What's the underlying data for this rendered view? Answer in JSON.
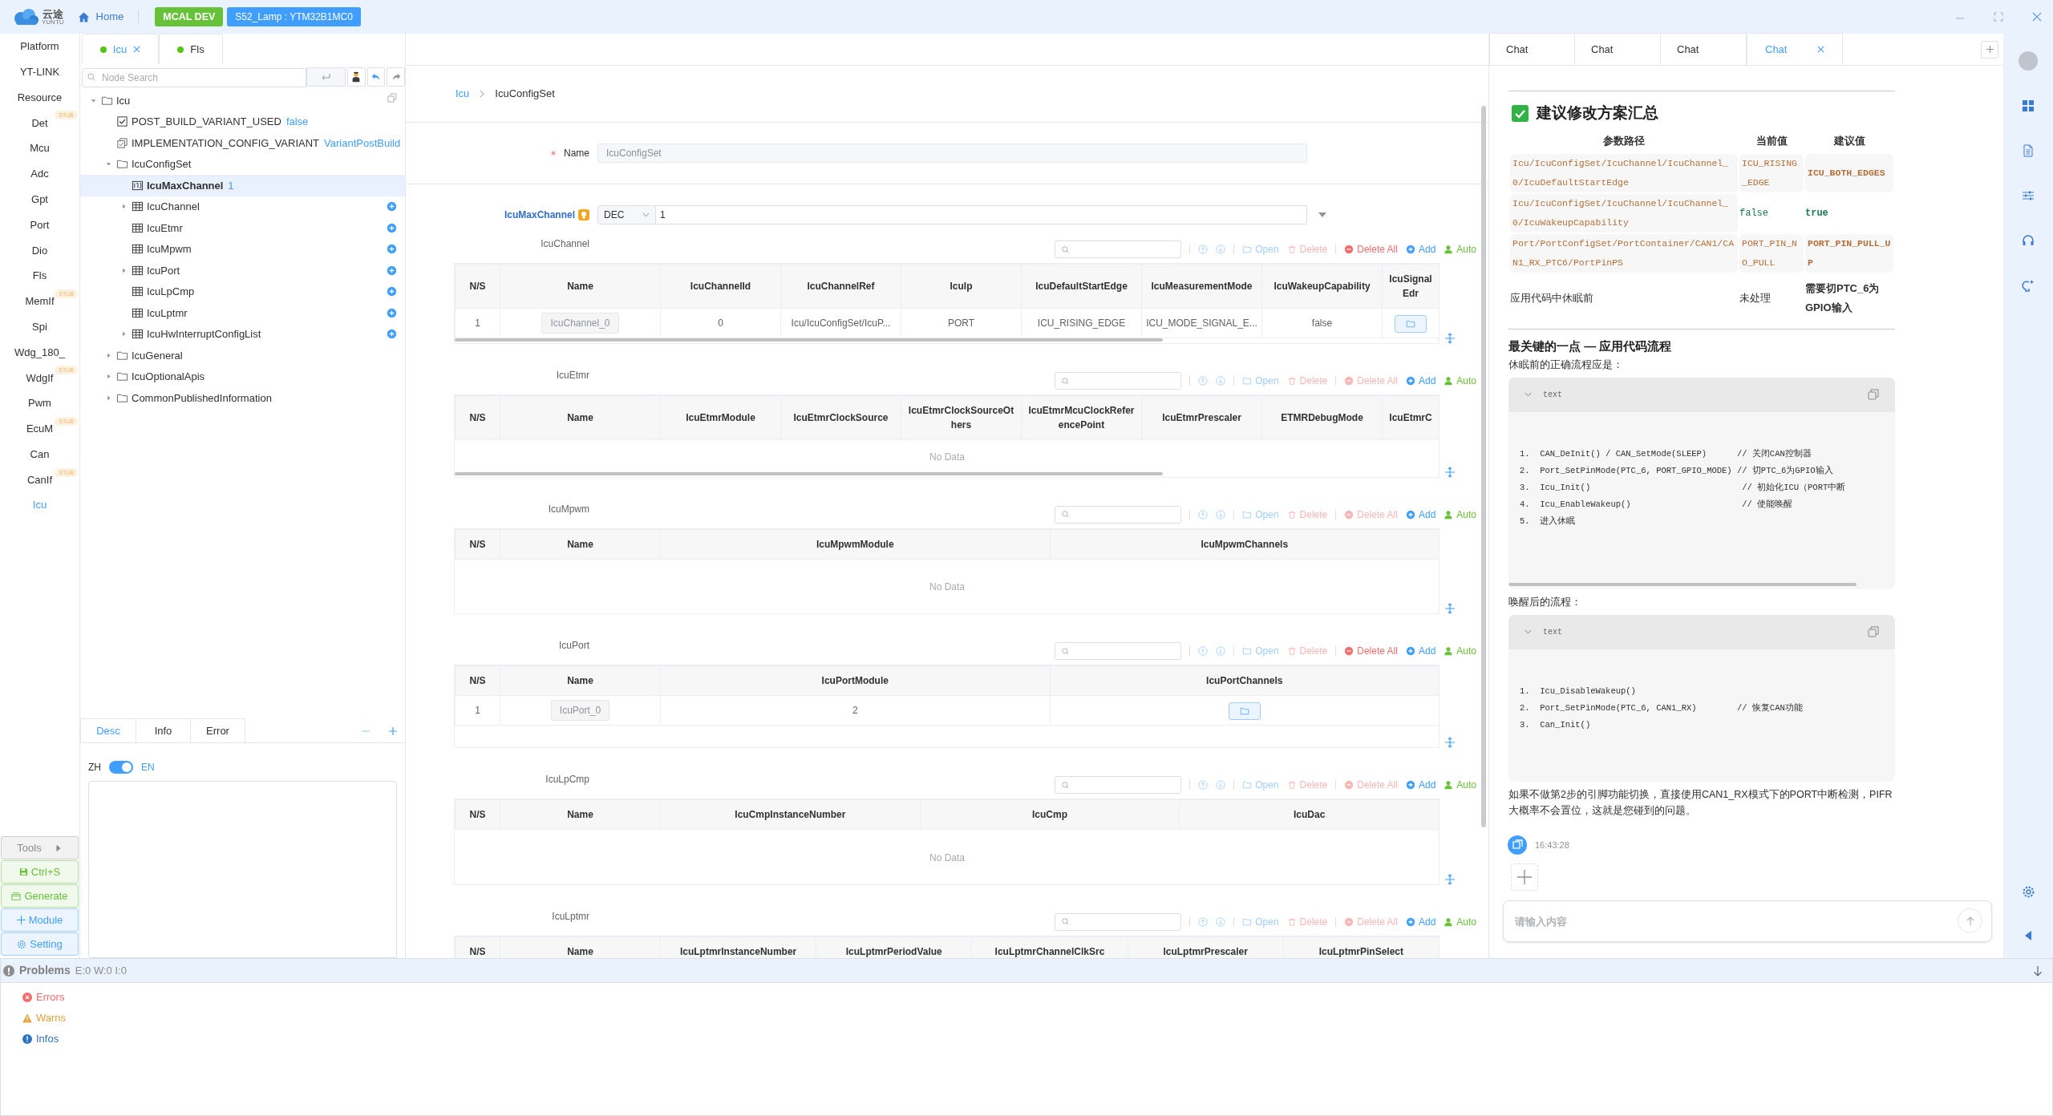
{
  "header": {
    "logo_text": "云途",
    "logo_subtext": "YUNTU",
    "home": "Home",
    "badges": [
      {
        "label": "MCAL DEV",
        "color": "#67c23a"
      },
      {
        "label": "S52_Lamp : YTM32B1MC0",
        "color": "#409eff"
      }
    ]
  },
  "nav": [
    {
      "label": "Platform",
      "selected": false
    },
    {
      "label": "YT-LINK",
      "selected": false
    },
    {
      "label": "Resource",
      "selected": false
    },
    {
      "label": "Det",
      "badge": "STUB",
      "selected": false
    },
    {
      "label": "Mcu",
      "selected": false
    },
    {
      "label": "Adc",
      "selected": false
    },
    {
      "label": "Gpt",
      "selected": false
    },
    {
      "label": "Port",
      "selected": false
    },
    {
      "label": "Dio",
      "selected": false
    },
    {
      "label": "Fls",
      "selected": false
    },
    {
      "label": "MemIf",
      "badge": "STUB",
      "selected": false
    },
    {
      "label": "Spi",
      "selected": false
    },
    {
      "label": "Wdg_180_",
      "selected": false
    },
    {
      "label": "WdgIf",
      "badge": "STUB",
      "selected": false
    },
    {
      "label": "Pwm",
      "selected": false
    },
    {
      "label": "EcuM",
      "badge": "STUB",
      "selected": false
    },
    {
      "label": "Can",
      "selected": false
    },
    {
      "label": "CanIf",
      "badge": "STUB",
      "selected": false
    },
    {
      "label": "Icu",
      "selected": true
    }
  ],
  "tools": [
    {
      "kind": "tools",
      "label": "Tools"
    },
    {
      "kind": "save",
      "label": "Ctrl+S"
    },
    {
      "kind": "generate",
      "label": "Generate"
    },
    {
      "kind": "module",
      "label": "Module"
    },
    {
      "kind": "setting",
      "label": "Setting"
    }
  ],
  "module_tabs": [
    {
      "label": "Icu",
      "selected": true
    },
    {
      "label": "Fls",
      "selected": false
    }
  ],
  "node_search": {
    "placeholder": "Node Search"
  },
  "tree": [
    {
      "label": "Icu",
      "kind": "folder",
      "expanded": true,
      "selected": false,
      "children": [
        {
          "label": "POST_BUILD_VARIANT_USED",
          "kind": "boolean",
          "value": "false",
          "selected": false
        },
        {
          "label": "IMPLEMENTATION_CONFIG_VARIANT",
          "kind": "enum",
          "value": "VariantPostBuild",
          "selected": false
        },
        {
          "label": "IcuConfigSet",
          "kind": "folder",
          "expanded": true,
          "selected": false,
          "children": [
            {
              "label": "IcuMaxChannel",
              "kind": "number",
              "value": "1",
              "selected": true
            },
            {
              "label": "IcuChannel",
              "kind": "table",
              "expanded": false,
              "add": true,
              "selected": false
            },
            {
              "label": "IcuEtmr",
              "kind": "table",
              "add": true,
              "selected": false
            },
            {
              "label": "IcuMpwm",
              "kind": "table",
              "add": true,
              "selected": false
            },
            {
              "label": "IcuPort",
              "kind": "table",
              "expanded": false,
              "add": true,
              "selected": false
            },
            {
              "label": "IcuLpCmp",
              "kind": "table",
              "add": true,
              "selected": false
            },
            {
              "label": "IcuLptmr",
              "kind": "table",
              "add": true,
              "selected": false
            },
            {
              "label": "IcuHwInterruptConfigList",
              "kind": "table",
              "expanded": false,
              "add": true,
              "selected": false
            }
          ]
        },
        {
          "label": "IcuGeneral",
          "kind": "folder",
          "expanded": false,
          "selected": false
        },
        {
          "label": "IcuOptionalApis",
          "kind": "folder",
          "expanded": false,
          "selected": false
        },
        {
          "label": "CommonPublishedInformation",
          "kind": "folder",
          "expanded": false,
          "selected": false
        }
      ]
    }
  ],
  "desc": {
    "tabs": [
      {
        "label": "Desc",
        "selected": true
      },
      {
        "label": "Info",
        "selected": false
      },
      {
        "label": "Error",
        "selected": false
      }
    ],
    "toggle": {
      "left": "ZH",
      "right": "EN",
      "on": true
    }
  },
  "breadcrumb": [
    "Icu",
    "IcuConfigSet"
  ],
  "name_field": {
    "label": "Name",
    "required": true,
    "value": "IcuConfigSet"
  },
  "max_channel": {
    "label": "IcuMaxChannel",
    "format": "DEC",
    "value": "1"
  },
  "tables": [
    {
      "title": "IcuChannel",
      "scroll": true,
      "actions": [
        {
          "kind": "open",
          "label": "Open",
          "enabled": false
        },
        {
          "kind": "delete",
          "label": "Delete",
          "enabled": false
        },
        {
          "kind": "delete_all",
          "label": "Delete All",
          "enabled": true
        },
        {
          "kind": "add",
          "label": "Add",
          "enabled": true
        },
        {
          "kind": "auto",
          "label": "Auto",
          "enabled": true
        }
      ],
      "columns": [
        "N/S",
        "Name",
        "IcuChannelId",
        "IcuChannelRef",
        "IcuIp",
        "IcuDefaultStartEdge",
        "IcuMeasurementMode",
        "IcuWakeupCapability",
        "IcuSignalEdr"
      ],
      "rows": [
        [
          "1",
          {
            "kind": "name",
            "text": "IcuChannel_0"
          },
          "0",
          "Icu/IcuConfigSet/IcuP...",
          "PORT",
          "ICU_RISING_EDGE",
          "ICU_MODE_SIGNAL_E...",
          "false",
          {
            "kind": "folder"
          }
        ]
      ]
    },
    {
      "title": "IcuEtmr",
      "scroll": true,
      "actions": [
        {
          "kind": "open",
          "label": "Open",
          "enabled": false
        },
        {
          "kind": "delete",
          "label": "Delete",
          "enabled": false
        },
        {
          "kind": "delete_all",
          "label": "Delete All",
          "enabled": false
        },
        {
          "kind": "add",
          "label": "Add",
          "enabled": true
        },
        {
          "kind": "auto",
          "label": "Auto",
          "enabled": true
        }
      ],
      "columns": [
        "N/S",
        "Name",
        "IcuEtmrModule",
        "IcuEtmrClockSource",
        "IcuEtmrClockSourceOthers",
        "IcuEtmrMcuClockReferencePoint",
        "IcuEtmrPrescaler",
        "ETMRDebugMode",
        "IcuEtmrC"
      ],
      "empty_text": "No Data"
    },
    {
      "title": "IcuMpwm",
      "scroll": false,
      "actions": [
        {
          "kind": "open",
          "label": "Open",
          "enabled": false
        },
        {
          "kind": "delete",
          "label": "Delete",
          "enabled": false
        },
        {
          "kind": "delete_all",
          "label": "Delete All",
          "enabled": false
        },
        {
          "kind": "add",
          "label": "Add",
          "enabled": true
        },
        {
          "kind": "auto",
          "label": "Auto",
          "enabled": true
        }
      ],
      "columns": [
        "N/S",
        "Name",
        "IcuMpwmModule",
        "IcuMpwmChannels"
      ],
      "empty_text": "No Data"
    },
    {
      "title": "IcuPort",
      "scroll": false,
      "actions": [
        {
          "kind": "open",
          "label": "Open",
          "enabled": false
        },
        {
          "kind": "delete",
          "label": "Delete",
          "enabled": false
        },
        {
          "kind": "delete_all",
          "label": "Delete All",
          "enabled": true
        },
        {
          "kind": "add",
          "label": "Add",
          "enabled": true
        },
        {
          "kind": "auto",
          "label": "Auto",
          "enabled": true
        }
      ],
      "columns": [
        "N/S",
        "Name",
        "IcuPortModule",
        "IcuPortChannels"
      ],
      "rows": [
        [
          "1",
          {
            "kind": "name",
            "text": "IcuPort_0"
          },
          "2",
          {
            "kind": "folder"
          }
        ]
      ]
    },
    {
      "title": "IcuLpCmp",
      "scroll": false,
      "actions": [
        {
          "kind": "open",
          "label": "Open",
          "enabled": false
        },
        {
          "kind": "delete",
          "label": "Delete",
          "enabled": false
        },
        {
          "kind": "delete_all",
          "label": "Delete All",
          "enabled": false
        },
        {
          "kind": "add",
          "label": "Add",
          "enabled": true
        },
        {
          "kind": "auto",
          "label": "Auto",
          "enabled": true
        }
      ],
      "columns": [
        "N/S",
        "Name",
        "IcuCmpInstanceNumber",
        "IcuCmp",
        "IcuDac"
      ],
      "empty_text": "No Data"
    },
    {
      "title": "IcuLptmr",
      "scroll": false,
      "actions": [
        {
          "kind": "open",
          "label": "Open",
          "enabled": false
        },
        {
          "kind": "delete",
          "label": "Delete",
          "enabled": false
        },
        {
          "kind": "delete_all",
          "label": "Delete All",
          "enabled": false
        },
        {
          "kind": "add",
          "label": "Add",
          "enabled": true
        },
        {
          "kind": "auto",
          "label": "Auto",
          "enabled": true
        }
      ],
      "columns": [
        "N/S",
        "Name",
        "IcuLptmrInstanceNumber",
        "IcuLptmrPeriodValue",
        "IcuLptmrChannelClkSrc",
        "IcuLptmrPrescaler",
        "IcuLptmrPinSelect"
      ]
    }
  ],
  "chat": {
    "tabs": [
      {
        "label": "Chat",
        "selected": false
      },
      {
        "label": "Chat",
        "selected": false
      },
      {
        "label": "Chat",
        "selected": false
      },
      {
        "label": "Chat",
        "selected": true
      }
    ],
    "blocks": [
      {
        "kind": "heading",
        "text": "建议修改方案汇总"
      },
      {
        "kind": "table",
        "columns": [
          "参数路径",
          "当前值",
          "建议值"
        ],
        "rows": [
          [
            {
              "kind": "code",
              "text": "Icu/IcuConfigSet/IcuChannel/IcuChannel_0/IcuDefaultStartEdge",
              "bold": false
            },
            {
              "kind": "code",
              "text": "ICU_RISING_EDGE",
              "bold": false
            },
            {
              "kind": "code",
              "text": "ICU_BOTH_EDGES",
              "bold": true
            }
          ],
          [
            {
              "kind": "code",
              "text": "Icu/IcuConfigSet/IcuChannel/IcuChannel_0/IcuWakeupCapability",
              "bold": false
            },
            {
              "kind": "keyword",
              "text": "false",
              "bold": false
            },
            {
              "kind": "keyword",
              "text": "true",
              "bold": true
            }
          ],
          [
            {
              "kind": "code",
              "text": "Port/PortConfigSet/PortContainer/CAN1/CAN1_RX_PTC6/PortPinPS",
              "bold": false
            },
            {
              "kind": "code",
              "text": "PORT_PIN_NO_PULL",
              "bold": false
            },
            {
              "kind": "code",
              "text": "PORT_PIN_PULL_UP",
              "bold": true
            }
          ],
          [
            {
              "kind": "plain",
              "text": "应用代码中休眠前",
              "bold": false
            },
            {
              "kind": "plain",
              "text": "未处理",
              "bold": false
            },
            {
              "kind": "plain",
              "text": "需要切PTC_6为GPIO输入",
              "bold": true
            }
          ]
        ]
      },
      {
        "kind": "subheading",
        "text": "最关键的一点 — 应用代码流程"
      },
      {
        "kind": "paragraph",
        "text": "休眠前的正确流程应是："
      },
      {
        "kind": "code",
        "lang": "text",
        "hscroll": true,
        "lines": [
          "1.  CAN_DeInit() / CAN_SetMode(SLEEP)      // 关闭CAN控制器",
          "2.  Port_SetPinMode(PTC_6, PORT_GPIO_MODE) // 切PTC_6为GPIO输入",
          "3.  Icu_Init()                              // 初始化ICU（PORT中断",
          "4.  Icu_EnableWakeup()                      // 使能唤醒",
          "5.  进入休眠"
        ]
      },
      {
        "kind": "paragraph",
        "text": "唤醒后的流程："
      },
      {
        "kind": "code",
        "lang": "text",
        "hscroll": false,
        "lines": [
          "1.  Icu_DisableWakeup()",
          "2.  Port_SetPinMode(PTC_6, CAN1_RX)        // 恢复CAN功能",
          "3.  Can_Init()"
        ]
      },
      {
        "kind": "paragraph",
        "text": "如果不做第2步的引脚功能切换，直接使用CAN1_RX模式下的PORT中断检测，PIFR大概率不会置位，这就是您碰到的问题。"
      }
    ],
    "time": "16:43:28",
    "input_placeholder": "请输入内容"
  },
  "problems": {
    "title": "Problems",
    "counts": "E:0 W:0 I:0",
    "items": [
      {
        "kind": "error",
        "label": "Errors"
      },
      {
        "kind": "warning",
        "label": "Warns"
      },
      {
        "kind": "info",
        "label": "Infos"
      }
    ]
  }
}
